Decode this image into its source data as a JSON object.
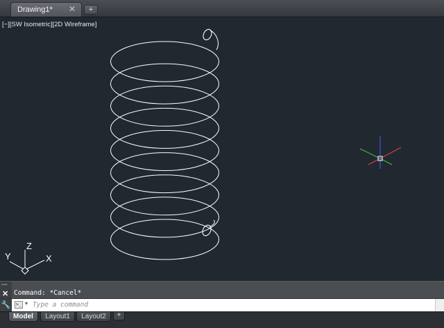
{
  "document_tab": {
    "title": "Drawing1*",
    "close_glyph": "✕",
    "new_tab_glyph": "+"
  },
  "viewport": {
    "controls_open": "[",
    "minus_label": "−",
    "sep1": "][",
    "view_label": "SW Isometric",
    "sep2": "][",
    "style_label": "2D Wireframe",
    "controls_close": "]",
    "background_color": "#212830",
    "object_color": "#ffffff"
  },
  "ucs_icon": {
    "x_label": "X",
    "y_label": "Y",
    "z_label": "Z"
  },
  "crosshair": {
    "x_axis_color": "#e04040",
    "y_axis_color": "#40c040",
    "z_axis_color": "#4060ff"
  },
  "command_line": {
    "history_text": "Command: *Cancel*",
    "input_placeholder": "Type a command",
    "input_value": "",
    "close_glyph": "✕",
    "wrench_glyph": "🔧",
    "prompt_glyph": ">_",
    "dropdown_glyph": "▾"
  },
  "layout_tabs": [
    {
      "label": "Model",
      "active": true
    },
    {
      "label": "Layout1",
      "active": false
    },
    {
      "label": "Layout2",
      "active": false
    }
  ],
  "layout_add_glyph": "+",
  "helix": {
    "turns": 9
  }
}
